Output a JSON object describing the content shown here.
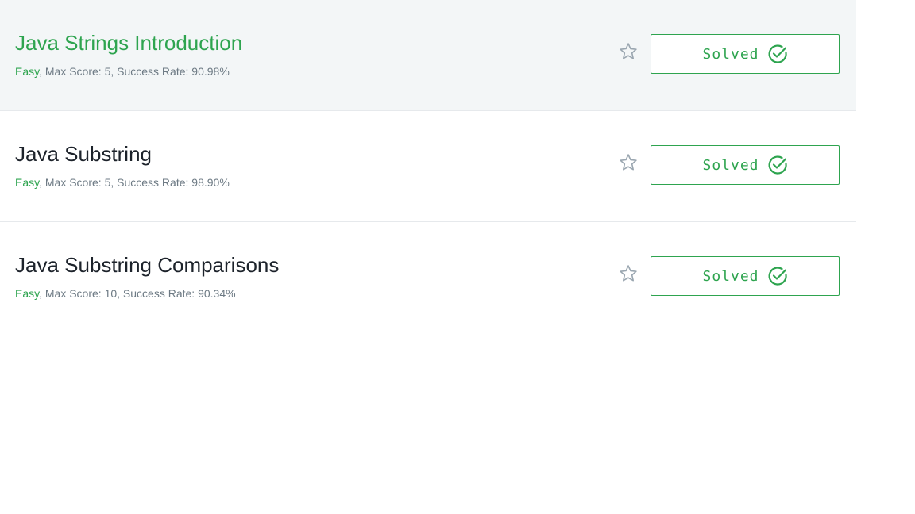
{
  "challenges": [
    {
      "title": "Java Strings Introduction",
      "difficulty": "Easy",
      "details": ", Max Score: 5, Success Rate: 90.98%",
      "status_label": "Solved",
      "hovered": true
    },
    {
      "title": "Java Substring",
      "difficulty": "Easy",
      "details": ", Max Score: 5, Success Rate: 98.90%",
      "status_label": "Solved",
      "hovered": false
    },
    {
      "title": "Java Substring Comparisons",
      "difficulty": "Easy",
      "details": ", Max Score: 10, Success Rate: 90.34%",
      "status_label": "Solved",
      "hovered": false
    }
  ],
  "icons": {
    "bookmark": "star-outline-icon",
    "status": "check-circle-icon"
  },
  "colors": {
    "accent": "#2ea44f",
    "title_text": "#1d232b",
    "meta_text": "#6d7a84",
    "star": "#9aa6b0",
    "hover_background": "#f3f6f7",
    "divider": "#e6e9ec"
  }
}
